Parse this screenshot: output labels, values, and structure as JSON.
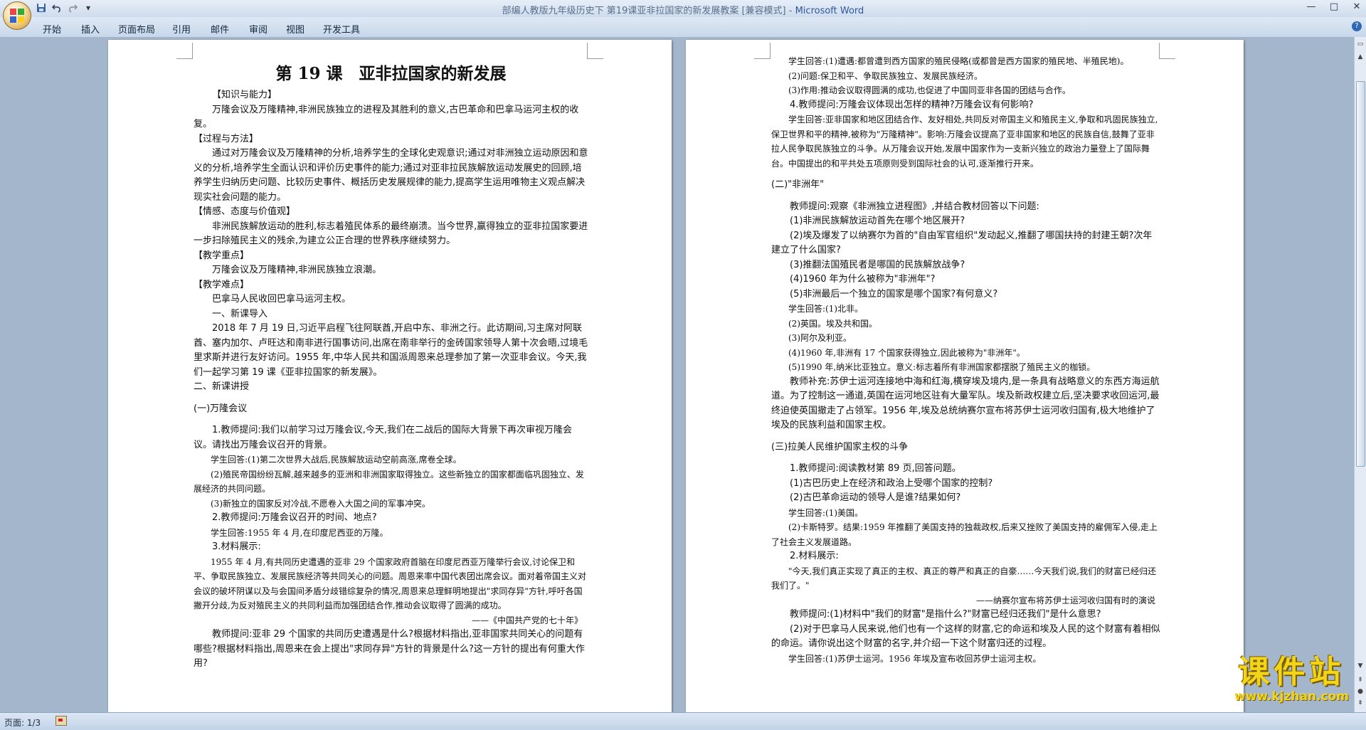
{
  "window": {
    "title": "部编人教版九年级历史下  第19课亚非拉国家的新发展教案 [兼容模式]",
    "app_name": "Microsoft Word",
    "title_separator": " - "
  },
  "quick_access": {
    "save_icon": "save-icon",
    "undo_icon": "undo-icon",
    "redo_icon": "redo-icon",
    "customize_icon": "dropdown-icon"
  },
  "ribbon": {
    "tabs": [
      "开始",
      "插入",
      "页面布局",
      "引用",
      "邮件",
      "审阅",
      "视图",
      "开发工具"
    ]
  },
  "status": {
    "page": "页面: 1/3"
  },
  "watermark": {
    "main": "课件站",
    "url": "www.kjzhan.com"
  },
  "colors": {
    "workspace": "#a4b6cc",
    "ribbon": "#cfdcec",
    "title_app": "#2d5a9e",
    "watermark": "#f2d51a"
  },
  "page1": {
    "title": "第 19 课　亚非拉国家的新发展",
    "paragraphs": [
      {
        "text": "",
        "cls": "p"
      },
      {
        "text": "【知识与能力】",
        "cls": "p ind"
      },
      {
        "text": "万隆会议及万隆精神,非洲民族独立的进程及其胜利的意义,古巴革命和巴拿马运河主权的收复。",
        "cls": "p ind"
      },
      {
        "text": "【过程与方法】",
        "cls": "p"
      },
      {
        "text": "通过对万隆会议及万隆精神的分析,培养学生的全球化史观意识;通过对非洲独立运动原因和意义的分析,培养学生全面认识和评价历史事件的能力;通过对亚非拉民族解放运动发展史的回顾,培养学生归纳历史问题、比较历史事件、概括历史发展规律的能力,提高学生运用唯物主义观点解决现实社会问题的能力。",
        "cls": "p ind"
      },
      {
        "text": "【情感、态度与价值观】",
        "cls": "p"
      },
      {
        "text": "非洲民族解放运动的胜利,标志着殖民体系的最终崩溃。当今世界,赢得独立的亚非拉国家要进一步扫除殖民主义的残余,为建立公正合理的世界秩序继续努力。",
        "cls": "p ind"
      },
      {
        "text": "【教学重点】",
        "cls": "p"
      },
      {
        "text": "万隆会议及万隆精神,非洲民族独立浪潮。",
        "cls": "p ind"
      },
      {
        "text": "【教学难点】",
        "cls": "p"
      },
      {
        "text": "巴拿马人民收回巴拿马运河主权。",
        "cls": "p ind"
      },
      {
        "text": "一、新课导入",
        "cls": "p ind"
      },
      {
        "text": "2018 年 7 月 19 日,习近平启程飞往阿联酋,开启中东、非洲之行。此访期间,习主席对阿联酋、塞内加尔、卢旺达和南非进行国事访问,出席在南非举行的金砖国家领导人第十次会晤,过境毛里求斯并进行友好访问。1955 年,中华人民共和国派周恩来总理参加了第一次亚非会议。今天,我们一起学习第 19 课《亚非拉国家的新发展》。",
        "cls": "p ind"
      },
      {
        "text": "二、新课讲授",
        "cls": "p"
      },
      {
        "text": "",
        "cls": "gap"
      },
      {
        "text": "(一)万隆会议",
        "cls": "p"
      },
      {
        "text": "",
        "cls": "gap"
      },
      {
        "text": "1.教师提问:我们以前学习过万隆会议,今天,我们在二战后的国际大背景下再次审视万隆会议。请找出万隆会议召开的背景。",
        "cls": "p ind"
      },
      {
        "text": "学生回答:(1)第二次世界大战后,民族解放运动空前高涨,席卷全球。",
        "cls": "hw ind"
      },
      {
        "text": "(2)殖民帝国纷纷瓦解,越来越多的亚洲和非洲国家取得独立。这些新独立的国家都面临巩固独立、发展经济的共同问题。",
        "cls": "hw ind"
      },
      {
        "text": "(3)新独立的国家反对冷战,不愿卷入大国之间的军事冲突。",
        "cls": "hw ind"
      },
      {
        "text": "2.教师提问:万隆会议召开的时间、地点?",
        "cls": "p ind"
      },
      {
        "text": "学生回答:1955 年 4 月,在印度尼西亚的万隆。",
        "cls": "hw ind"
      },
      {
        "text": "3.材料展示:",
        "cls": "p ind"
      },
      {
        "text": "1955 年 4 月,有共同历史遭遇的亚非 29 个国家政府首脑在印度尼西亚万隆举行会议,讨论保卫和平、争取民族独立、发展民族经济等共同关心的问题。周恩来率中国代表团出席会议。面对着帝国主义对会议的破坏阴谋以及与会国间矛盾分歧错综复杂的情况,周恩来总理鲜明地提出\"求同存异\"方针,呼吁各国撇开分歧,为反对殖民主义的共同利益而加强团结合作,推动会议取得了圆满的成功。",
        "cls": "hw ind"
      },
      {
        "text": "——《中国共产党的七十年》",
        "cls": "hw right"
      },
      {
        "text": "教师提问:亚非 29 个国家的共同历史遭遇是什么?根据材料指出,亚非国家共同关心的问题有哪些?根据材料指出,周恩来在会上提出\"求同存异\"方针的背景是什么?这一方针的提出有何重大作用?",
        "cls": "p ind"
      }
    ]
  },
  "page2": {
    "paragraphs": [
      {
        "text": "学生回答:(1)遭遇:都曾遭到西方国家的殖民侵略(或都曾是西方国家的殖民地、半殖民地)。",
        "cls": "hw ind"
      },
      {
        "text": "(2)问题:保卫和平、争取民族独立、发展民族经济。",
        "cls": "hw ind"
      },
      {
        "text": "(3)作用:推动会议取得圆满的成功,也促进了中国同亚非各国的团结与合作。",
        "cls": "hw ind"
      },
      {
        "text": "4.教师提问:万隆会议体现出怎样的精神?万隆会议有何影响?",
        "cls": "p ind"
      },
      {
        "text": "学生回答:亚非国家和地区团结合作、友好相处,共同反对帝国主义和殖民主义,争取和巩固民族独立,保卫世界和平的精神,被称为\"万隆精神\"。影响:万隆会议提高了亚非国家和地区的民族自信,鼓舞了亚非拉人民争取民族独立的斗争。从万隆会议开始,发展中国家作为一支新兴独立的政治力量登上了国际舞台。中国提出的和平共处五项原则受到国际社会的认可,逐渐推行开来。",
        "cls": "hw ind"
      },
      {
        "text": "",
        "cls": "gap"
      },
      {
        "text": "(二)\"非洲年\"",
        "cls": "p"
      },
      {
        "text": "",
        "cls": "gap"
      },
      {
        "text": "教师提问:观察《非洲独立进程图》,并结合教材回答以下问题:",
        "cls": "p ind"
      },
      {
        "text": "(1)非洲民族解放运动首先在哪个地区展开?",
        "cls": "p ind"
      },
      {
        "text": "(2)埃及爆发了以纳赛尔为首的\"自由军官组织\"发动起义,推翻了哪国扶持的封建王朝?次年建立了什么国家?",
        "cls": "p ind"
      },
      {
        "text": "(3)推翻法国殖民者是哪国的民族解放战争?",
        "cls": "p ind"
      },
      {
        "text": "(4)1960 年为什么被称为\"非洲年\"?",
        "cls": "p ind"
      },
      {
        "text": "(5)非洲最后一个独立的国家是哪个国家?有何意义?",
        "cls": "p ind"
      },
      {
        "text": "学生回答:(1)北非。",
        "cls": "hw ind"
      },
      {
        "text": "(2)英国。埃及共和国。",
        "cls": "hw ind"
      },
      {
        "text": "(3)阿尔及利亚。",
        "cls": "hw ind"
      },
      {
        "text": "(4)1960 年,非洲有 17 个国家获得独立,因此被称为\"非洲年\"。",
        "cls": "hw ind"
      },
      {
        "text": "(5)1990 年,纳米比亚独立。意义:标志着所有非洲国家都摆脱了殖民主义的枷锁。",
        "cls": "hw ind"
      },
      {
        "text": "教师补充:苏伊士运河连接地中海和红海,横穿埃及境内,是一条具有战略意义的东西方海运航道。为了控制这一通道,英国在运河地区驻有大量军队。埃及新政权建立后,坚决要求收回运河,最终迫使英国撤走了占领军。1956 年,埃及总统纳赛尔宣布将苏伊士运河收归国有,极大地维护了埃及的民族利益和国家主权。",
        "cls": "p ind"
      },
      {
        "text": "",
        "cls": "gap"
      },
      {
        "text": "(三)拉美人民维护国家主权的斗争",
        "cls": "p"
      },
      {
        "text": "",
        "cls": "gap"
      },
      {
        "text": "1.教师提问:阅读教材第 89 页,回答问题。",
        "cls": "p ind"
      },
      {
        "text": "(1)古巴历史上在经济和政治上受哪个国家的控制?",
        "cls": "p ind"
      },
      {
        "text": "(2)古巴革命运动的领导人是谁?结果如何?",
        "cls": "p ind"
      },
      {
        "text": "学生回答:(1)美国。",
        "cls": "hw ind"
      },
      {
        "text": "(2)卡斯特罗。结果:1959 年推翻了美国支持的独裁政权,后来又挫败了美国支持的雇佣军入侵,走上了社会主义发展道路。",
        "cls": "hw ind"
      },
      {
        "text": "2.材料展示:",
        "cls": "p ind"
      },
      {
        "text": "\"今天,我们真正实现了真正的主权、真正的尊严和真正的自豪……今天我们说,我们的财富已经归还我们了。\"",
        "cls": "hw ind"
      },
      {
        "text": "——纳赛尔宣布将苏伊士运河收归国有时的演说",
        "cls": "hw right"
      },
      {
        "text": "教师提问:(1)材料中\"我们的财富\"是指什么?\"财富已经归还我们\"是什么意思?",
        "cls": "p ind"
      },
      {
        "text": "(2)对于巴拿马人民来说,他们也有一个这样的财富,它的命运和埃及人民的这个财富有着相似的命运。请你说出这个财富的名字,并介绍一下这个财富归还的过程。",
        "cls": "p ind"
      },
      {
        "text": "学生回答:(1)苏伊士运河。1956 年埃及宣布收回苏伊士运河主权。",
        "cls": "hw ind"
      }
    ]
  }
}
